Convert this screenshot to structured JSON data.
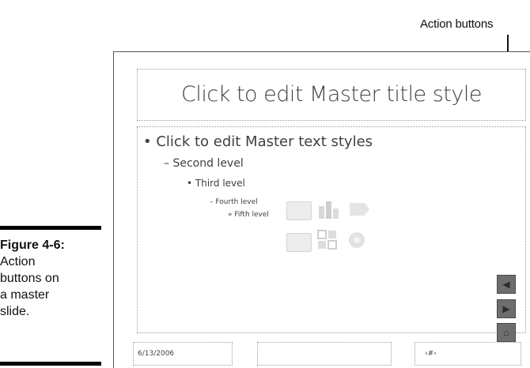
{
  "callout": {
    "label": "Action buttons"
  },
  "caption": {
    "title": "Figure 4-6:",
    "lines": [
      "Action",
      "buttons on",
      "a master",
      "slide."
    ]
  },
  "slide": {
    "title": "Click to edit Master title style",
    "body_levels": [
      "Click to edit Master text styles",
      "Second level",
      "Third level",
      "Fourth level",
      "Fifth level"
    ],
    "bullets": [
      "•",
      "–",
      "•",
      "–",
      "»"
    ],
    "footer": {
      "date": "6/13/2006",
      "center": "",
      "slide_number": "‹#›"
    },
    "action_buttons": [
      {
        "name": "back",
        "icon": "triangle-left-icon"
      },
      {
        "name": "forward",
        "icon": "triangle-right-icon"
      },
      {
        "name": "home",
        "icon": "home-icon"
      }
    ],
    "placeholder_icons": [
      "table-icon",
      "chart-icon",
      "smartart-icon",
      "picture-icon",
      "clipart-icon",
      "media-icon"
    ]
  }
}
